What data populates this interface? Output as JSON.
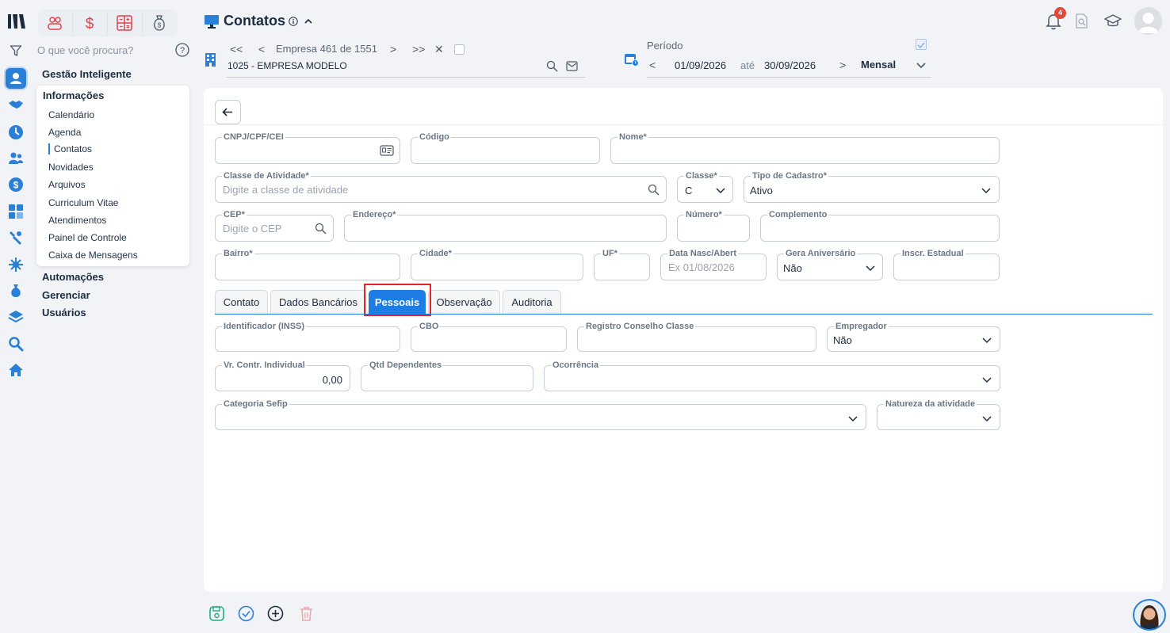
{
  "app": {
    "search_placeholder": "O que você procura?",
    "menu": {
      "gestao": "Gestão Inteligente",
      "informacoes": "Informações",
      "items": [
        "Calendário",
        "Agenda",
        "Contatos",
        "Novidades",
        "Arquivos",
        "Curriculum Vitae",
        "Atendimentos",
        "Painel de Controle",
        "Caixa de Mensagens"
      ],
      "automacoes": "Automações",
      "gerenciar": "Gerenciar",
      "usuarios": "Usuários"
    }
  },
  "header": {
    "title": "Contatos",
    "notifications_count": "4",
    "empresa_counter": "Empresa 461 de 1551",
    "empresa_name": "1025 - EMPRESA MODELO",
    "nav": {
      "first": "<<",
      "prev": "<",
      "next": ">",
      "last": ">>",
      "close": "✕"
    },
    "periodo": {
      "label": "Período",
      "prev": "<",
      "start": "01/09/2026",
      "ate": "até",
      "end": "30/09/2026",
      "next": ">",
      "mode": "Mensal"
    }
  },
  "form": {
    "cnpj": {
      "label": "CNPJ/CPF/CEI",
      "value": ""
    },
    "codigo": {
      "label": "Código",
      "value": ""
    },
    "nome": {
      "label": "Nome*",
      "value": ""
    },
    "classe_atividade": {
      "label": "Classe de Atividade*",
      "placeholder": "Digite a classe de atividade"
    },
    "classe": {
      "label": "Classe*",
      "value": "C"
    },
    "tipo_cadastro": {
      "label": "Tipo de Cadastro*",
      "value": "Ativo"
    },
    "cep": {
      "label": "CEP*",
      "placeholder": "Digite o CEP"
    },
    "endereco": {
      "label": "Endereço*",
      "value": ""
    },
    "numero": {
      "label": "Número*",
      "value": ""
    },
    "complemento": {
      "label": "Complemento",
      "value": ""
    },
    "bairro": {
      "label": "Bairro*",
      "value": ""
    },
    "cidade": {
      "label": "Cidade*",
      "value": ""
    },
    "uf": {
      "label": "UF*",
      "value": ""
    },
    "data_nasc": {
      "label": "Data Nasc/Abert",
      "placeholder": "Ex 01/08/2026"
    },
    "gera_aniversario": {
      "label": "Gera Aniversário",
      "value": "Não"
    },
    "inscr_estadual": {
      "label": "Inscr. Estadual",
      "value": ""
    }
  },
  "tabs": [
    "Contato",
    "Dados Bancários",
    "Pessoais",
    "Observação",
    "Auditoria"
  ],
  "active_tab": "Pessoais",
  "pessoais": {
    "identificador": {
      "label": "Identificador (INSS)",
      "value": ""
    },
    "cbo": {
      "label": "CBO",
      "value": ""
    },
    "registro": {
      "label": "Registro Conselho Classe",
      "value": ""
    },
    "empregador": {
      "label": "Empregador",
      "value": "Não"
    },
    "vr_contr": {
      "label": "Vr. Contr. Individual",
      "value": "0,00"
    },
    "qtd_dependentes": {
      "label": "Qtd Dependentes",
      "value": ""
    },
    "ocorrencia": {
      "label": "Ocorrência",
      "value": ""
    },
    "categoria_sefip": {
      "label": "Categoria Sefip",
      "value": ""
    },
    "natureza": {
      "label": "Natureza da atividade",
      "value": ""
    }
  },
  "colors": {
    "primary": "#1e7de5",
    "highlight": "#e4262c",
    "badge": "#e4473c",
    "shortcut_red": "#e0434b"
  },
  "icons": [
    "logo-icon",
    "filter-icon",
    "contacts-icon",
    "handshake-icon",
    "clock-icon",
    "people-icon",
    "dollar-icon",
    "calculator-icon",
    "tools-icon",
    "network-icon",
    "money-bag-icon",
    "layers-icon",
    "search-icon",
    "home-icon",
    "bell-icon",
    "document-search-icon",
    "graduation-cap-icon",
    "save-icon",
    "check-icon",
    "plus-icon",
    "trash-icon"
  ]
}
